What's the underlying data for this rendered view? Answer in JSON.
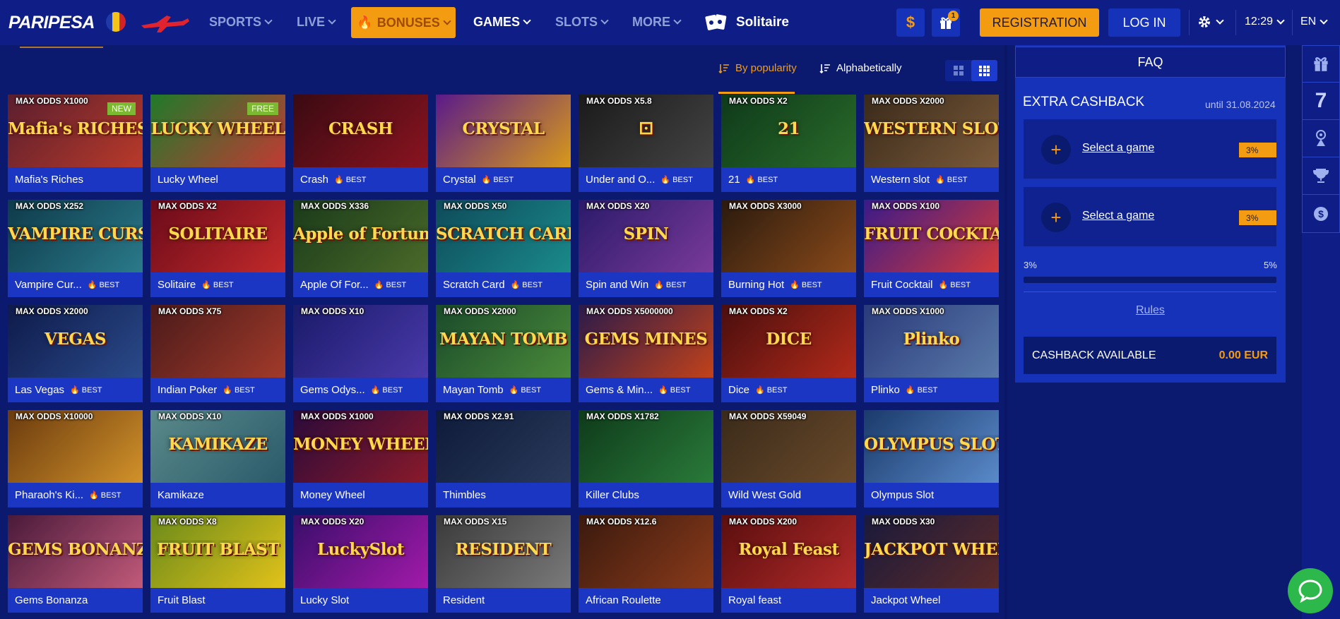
{
  "header": {
    "logo": "PARIPESA",
    "nav": [
      {
        "label": "SPORTS"
      },
      {
        "label": "LIVE"
      },
      {
        "label": "BONUSES"
      },
      {
        "label": "GAMES"
      },
      {
        "label": "SLOTS"
      },
      {
        "label": "MORE"
      }
    ],
    "current_game": "Solitaire",
    "currency_symbol": "$",
    "gift_count": "1",
    "registration": "REGISTRATION",
    "login": "LOG IN",
    "time": "12:29",
    "language": "EN"
  },
  "sort": {
    "popularity": "By popularity",
    "alphabetical": "Alphabetically"
  },
  "games": [
    {
      "name": "Mafia's Riches",
      "odds": "MAX ODDS X1000",
      "badge": "NEW",
      "best": false,
      "art": "Mafia's RICHES",
      "bg": [
        "#5a1e2e",
        "#b93a2a"
      ]
    },
    {
      "name": "Lucky Wheel",
      "odds": "",
      "badge": "FREE",
      "best": false,
      "art": "LUCKY WHEEL",
      "bg": [
        "#1f7a2a",
        "#c23a34"
      ]
    },
    {
      "name": "Crash",
      "odds": "",
      "badge": "",
      "best": true,
      "art": "CRASH",
      "bg": [
        "#3a0a12",
        "#8a1420"
      ]
    },
    {
      "name": "Crystal",
      "odds": "",
      "badge": "",
      "best": true,
      "art": "CRYSTAL",
      "bg": [
        "#5a1a8a",
        "#d89a1a"
      ]
    },
    {
      "name": "Under and O...",
      "odds": "MAX ODDS X5.8",
      "badge": "",
      "best": true,
      "art": "⚀",
      "bg": [
        "#1a1a1a",
        "#444"
      ]
    },
    {
      "name": "21",
      "odds": "MAX ODDS X2",
      "badge": "",
      "best": true,
      "art": "21",
      "bg": [
        "#0e3a1a",
        "#2a6a2a"
      ]
    },
    {
      "name": "Western slot",
      "odds": "MAX ODDS X2000",
      "badge": "",
      "best": true,
      "art": "WESTERN SLOT",
      "bg": [
        "#3a2a1a",
        "#7a5a3a"
      ]
    },
    {
      "name": "Vampire Cur...",
      "odds": "MAX ODDS X252",
      "badge": "",
      "best": true,
      "art": "VAMPIRE CURSE",
      "bg": [
        "#0e3a4a",
        "#2a7a8a"
      ]
    },
    {
      "name": "Solitaire",
      "odds": "MAX ODDS X2",
      "badge": "",
      "best": true,
      "art": "SOLITAIRE",
      "bg": [
        "#6a0a1a",
        "#c22a2a"
      ]
    },
    {
      "name": "Apple Of For...",
      "odds": "MAX ODDS X336",
      "badge": "",
      "best": true,
      "art": "Apple of Fortune",
      "bg": [
        "#1a3a1a",
        "#4a6a2a"
      ]
    },
    {
      "name": "Scratch Card",
      "odds": "MAX ODDS X50",
      "badge": "",
      "best": true,
      "art": "SCRATCH CARD",
      "bg": [
        "#0e4a5a",
        "#1a8a8a"
      ]
    },
    {
      "name": "Spin and Win",
      "odds": "MAX ODDS X20",
      "badge": "",
      "best": true,
      "art": "SPIN",
      "bg": [
        "#2a1a6a",
        "#7a3a9a"
      ]
    },
    {
      "name": "Burning Hot",
      "odds": "MAX ODDS X3000",
      "badge": "",
      "best": true,
      "art": "",
      "bg": [
        "#2a1a0e",
        "#8a4a1a"
      ]
    },
    {
      "name": "Fruit Cocktail",
      "odds": "MAX ODDS X100",
      "badge": "",
      "best": true,
      "art": "FRUIT COCKTAIL",
      "bg": [
        "#3a1a8a",
        "#d23a3a"
      ]
    },
    {
      "name": "Las Vegas",
      "odds": "MAX ODDS X2000",
      "badge": "",
      "best": true,
      "art": "VEGAS",
      "bg": [
        "#0e1a4a",
        "#2a4a8a"
      ]
    },
    {
      "name": "Indian Poker",
      "odds": "MAX ODDS X75",
      "badge": "",
      "best": true,
      "art": "",
      "bg": [
        "#4a1a1a",
        "#a23a2a"
      ]
    },
    {
      "name": "Gems Odys...",
      "odds": "MAX ODDS X10",
      "badge": "",
      "best": true,
      "art": "",
      "bg": [
        "#1a1a6a",
        "#4a3aaa"
      ]
    },
    {
      "name": "Mayan Tomb",
      "odds": "MAX ODDS X2000",
      "badge": "",
      "best": true,
      "art": "MAYAN TOMB",
      "bg": [
        "#1a4a2a",
        "#4a8a3a"
      ]
    },
    {
      "name": "Gems & Min...",
      "odds": "MAX ODDS X5000000",
      "badge": "",
      "best": true,
      "art": "GEMS MINES",
      "bg": [
        "#2a1a4a",
        "#c2421a"
      ]
    },
    {
      "name": "Dice",
      "odds": "MAX ODDS X2",
      "badge": "",
      "best": true,
      "art": "DICE",
      "bg": [
        "#4a0e0e",
        "#b22a1a"
      ]
    },
    {
      "name": "Plinko",
      "odds": "MAX ODDS X1000",
      "badge": "",
      "best": true,
      "art": "Plinko",
      "bg": [
        "#2a3a7a",
        "#5a7aaa"
      ]
    },
    {
      "name": "Pharaoh's Ki...",
      "odds": "MAX ODDS X10000",
      "badge": "",
      "best": true,
      "art": "",
      "bg": [
        "#6a3a0e",
        "#d2922a"
      ]
    },
    {
      "name": "Kamikaze",
      "odds": "MAX ODDS X10",
      "badge": "",
      "best": false,
      "art": "KAMIKAZE",
      "bg": [
        "#5a8a8a",
        "#2a5a6a"
      ]
    },
    {
      "name": "Money Wheel",
      "odds": "MAX ODDS X1000",
      "badge": "",
      "best": false,
      "art": "MONEY WHEEL",
      "bg": [
        "#2a0a3a",
        "#8a1a2a"
      ]
    },
    {
      "name": "Thimbles",
      "odds": "MAX ODDS X2.91",
      "badge": "",
      "best": false,
      "art": "",
      "bg": [
        "#0e1a3a",
        "#2a3a5a"
      ]
    },
    {
      "name": "Killer Clubs",
      "odds": "MAX ODDS X1782",
      "badge": "",
      "best": false,
      "art": "",
      "bg": [
        "#0e3a1a",
        "#2a7a3a"
      ]
    },
    {
      "name": "Wild West Gold",
      "odds": "MAX ODDS X59049",
      "badge": "",
      "best": false,
      "art": "",
      "bg": [
        "#3a2a1a",
        "#6a4a2a"
      ]
    },
    {
      "name": "Olympus Slot",
      "odds": "",
      "badge": "",
      "best": false,
      "art": "OLYMPUS SLOT",
      "bg": [
        "#1a3a6a",
        "#5a8aca"
      ]
    },
    {
      "name": "Gems Bonanza",
      "odds": "",
      "badge": "",
      "best": false,
      "art": "GEMS BONANZA",
      "bg": [
        "#4a1a3a",
        "#c25a7a"
      ]
    },
    {
      "name": "Fruit Blast",
      "odds": "MAX ODDS X8",
      "badge": "",
      "best": false,
      "art": "FRUIT BLAST",
      "bg": [
        "#6a8a1a",
        "#e2c21a"
      ]
    },
    {
      "name": "Lucky Slot",
      "odds": "MAX ODDS X20",
      "badge": "",
      "best": false,
      "art": "LuckySlot",
      "bg": [
        "#3a0e6a",
        "#a21aaa"
      ]
    },
    {
      "name": "Resident",
      "odds": "MAX ODDS X15",
      "badge": "",
      "best": false,
      "art": "RESIDENT",
      "bg": [
        "#3a3a3a",
        "#7a7a7a"
      ]
    },
    {
      "name": "African Roulette",
      "odds": "MAX ODDS X12.6",
      "badge": "",
      "best": false,
      "art": "",
      "bg": [
        "#3a1a0e",
        "#8a3a1a"
      ]
    },
    {
      "name": "Royal feast",
      "odds": "MAX ODDS X200",
      "badge": "",
      "best": false,
      "art": "Royal Feast",
      "bg": [
        "#5a0e0e",
        "#b22a2a"
      ]
    },
    {
      "name": "Jackpot Wheel",
      "odds": "MAX ODDS X30",
      "badge": "",
      "best": false,
      "art": "JACKPOT WHEEL",
      "bg": [
        "#1a1a3a",
        "#5a2a2a"
      ]
    }
  ],
  "best_label": "BEST",
  "panel": {
    "faq": "FAQ",
    "title": "EXTRA CASHBACK",
    "until": "until 31.08.2024",
    "slots": [
      {
        "label": "Select a game",
        "pct": "3%"
      },
      {
        "label": "Select a game",
        "pct": "3%"
      }
    ],
    "range_min": "3%",
    "range_max": "5%",
    "rules": "Rules",
    "available_label": "CASHBACK AVAILABLE",
    "available_amount": "0.00 EUR"
  },
  "rail": {
    "seven": "7"
  }
}
